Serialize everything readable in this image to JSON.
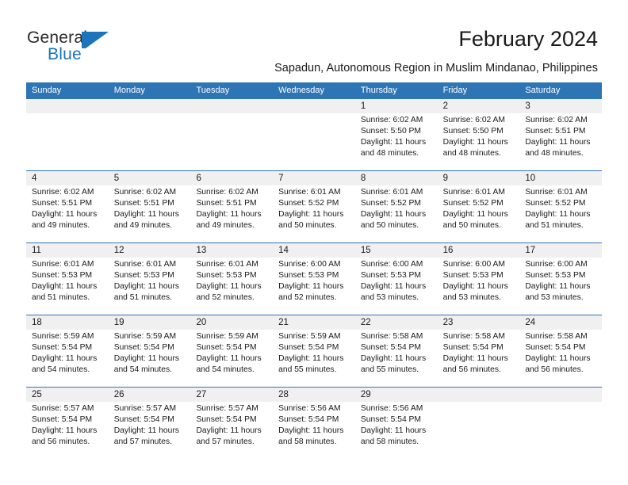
{
  "logo": {
    "word_dark": "General",
    "word_blue": "Blue",
    "flag_icon": "blue-flag-triangle"
  },
  "header": {
    "title": "February 2024",
    "subtitle": "Sapadun, Autonomous Region in Muslim Mindanao, Philippines"
  },
  "colors": {
    "header_blue": "#2e75b6",
    "logo_blue": "#1b74bc",
    "day_band_gray": "#f0f0f0",
    "text": "#1a1a1a"
  },
  "weekdays": [
    "Sunday",
    "Monday",
    "Tuesday",
    "Wednesday",
    "Thursday",
    "Friday",
    "Saturday"
  ],
  "weeks": [
    [
      {
        "day": "",
        "info": ""
      },
      {
        "day": "",
        "info": ""
      },
      {
        "day": "",
        "info": ""
      },
      {
        "day": "",
        "info": ""
      },
      {
        "day": "1",
        "info": "Sunrise: 6:02 AM\nSunset: 5:50 PM\nDaylight: 11 hours\nand 48 minutes."
      },
      {
        "day": "2",
        "info": "Sunrise: 6:02 AM\nSunset: 5:50 PM\nDaylight: 11 hours\nand 48 minutes."
      },
      {
        "day": "3",
        "info": "Sunrise: 6:02 AM\nSunset: 5:51 PM\nDaylight: 11 hours\nand 48 minutes."
      }
    ],
    [
      {
        "day": "4",
        "info": "Sunrise: 6:02 AM\nSunset: 5:51 PM\nDaylight: 11 hours\nand 49 minutes."
      },
      {
        "day": "5",
        "info": "Sunrise: 6:02 AM\nSunset: 5:51 PM\nDaylight: 11 hours\nand 49 minutes."
      },
      {
        "day": "6",
        "info": "Sunrise: 6:02 AM\nSunset: 5:51 PM\nDaylight: 11 hours\nand 49 minutes."
      },
      {
        "day": "7",
        "info": "Sunrise: 6:01 AM\nSunset: 5:52 PM\nDaylight: 11 hours\nand 50 minutes."
      },
      {
        "day": "8",
        "info": "Sunrise: 6:01 AM\nSunset: 5:52 PM\nDaylight: 11 hours\nand 50 minutes."
      },
      {
        "day": "9",
        "info": "Sunrise: 6:01 AM\nSunset: 5:52 PM\nDaylight: 11 hours\nand 50 minutes."
      },
      {
        "day": "10",
        "info": "Sunrise: 6:01 AM\nSunset: 5:52 PM\nDaylight: 11 hours\nand 51 minutes."
      }
    ],
    [
      {
        "day": "11",
        "info": "Sunrise: 6:01 AM\nSunset: 5:53 PM\nDaylight: 11 hours\nand 51 minutes."
      },
      {
        "day": "12",
        "info": "Sunrise: 6:01 AM\nSunset: 5:53 PM\nDaylight: 11 hours\nand 51 minutes."
      },
      {
        "day": "13",
        "info": "Sunrise: 6:01 AM\nSunset: 5:53 PM\nDaylight: 11 hours\nand 52 minutes."
      },
      {
        "day": "14",
        "info": "Sunrise: 6:00 AM\nSunset: 5:53 PM\nDaylight: 11 hours\nand 52 minutes."
      },
      {
        "day": "15",
        "info": "Sunrise: 6:00 AM\nSunset: 5:53 PM\nDaylight: 11 hours\nand 53 minutes."
      },
      {
        "day": "16",
        "info": "Sunrise: 6:00 AM\nSunset: 5:53 PM\nDaylight: 11 hours\nand 53 minutes."
      },
      {
        "day": "17",
        "info": "Sunrise: 6:00 AM\nSunset: 5:53 PM\nDaylight: 11 hours\nand 53 minutes."
      }
    ],
    [
      {
        "day": "18",
        "info": "Sunrise: 5:59 AM\nSunset: 5:54 PM\nDaylight: 11 hours\nand 54 minutes."
      },
      {
        "day": "19",
        "info": "Sunrise: 5:59 AM\nSunset: 5:54 PM\nDaylight: 11 hours\nand 54 minutes."
      },
      {
        "day": "20",
        "info": "Sunrise: 5:59 AM\nSunset: 5:54 PM\nDaylight: 11 hours\nand 54 minutes."
      },
      {
        "day": "21",
        "info": "Sunrise: 5:59 AM\nSunset: 5:54 PM\nDaylight: 11 hours\nand 55 minutes."
      },
      {
        "day": "22",
        "info": "Sunrise: 5:58 AM\nSunset: 5:54 PM\nDaylight: 11 hours\nand 55 minutes."
      },
      {
        "day": "23",
        "info": "Sunrise: 5:58 AM\nSunset: 5:54 PM\nDaylight: 11 hours\nand 56 minutes."
      },
      {
        "day": "24",
        "info": "Sunrise: 5:58 AM\nSunset: 5:54 PM\nDaylight: 11 hours\nand 56 minutes."
      }
    ],
    [
      {
        "day": "25",
        "info": "Sunrise: 5:57 AM\nSunset: 5:54 PM\nDaylight: 11 hours\nand 56 minutes."
      },
      {
        "day": "26",
        "info": "Sunrise: 5:57 AM\nSunset: 5:54 PM\nDaylight: 11 hours\nand 57 minutes."
      },
      {
        "day": "27",
        "info": "Sunrise: 5:57 AM\nSunset: 5:54 PM\nDaylight: 11 hours\nand 57 minutes."
      },
      {
        "day": "28",
        "info": "Sunrise: 5:56 AM\nSunset: 5:54 PM\nDaylight: 11 hours\nand 58 minutes."
      },
      {
        "day": "29",
        "info": "Sunrise: 5:56 AM\nSunset: 5:54 PM\nDaylight: 11 hours\nand 58 minutes."
      },
      {
        "day": "",
        "info": ""
      },
      {
        "day": "",
        "info": ""
      }
    ]
  ]
}
